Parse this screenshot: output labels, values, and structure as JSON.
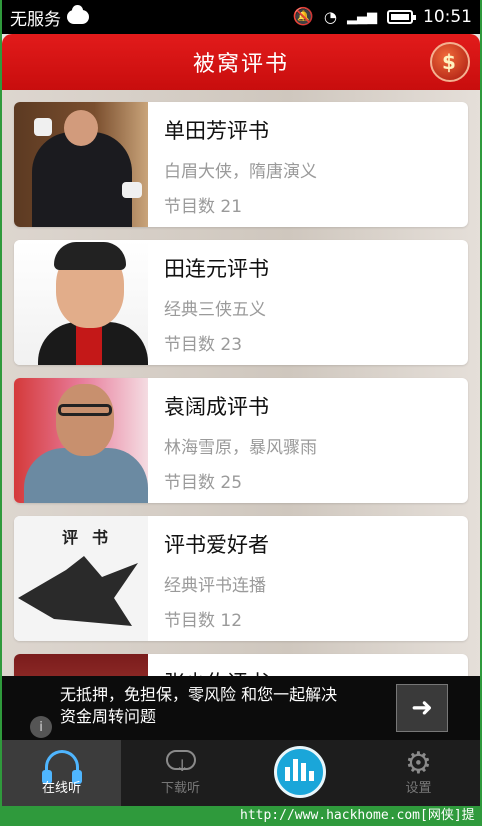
{
  "status_bar": {
    "carrier": "无服务",
    "time": "10:51"
  },
  "header": {
    "title": "被窝评书"
  },
  "list": [
    {
      "title": "单田芳评书",
      "subtitle": "白眉大侠，隋唐演义",
      "count": "节目数 21"
    },
    {
      "title": "田连元评书",
      "subtitle": "经典三侠五义",
      "count": "节目数 23"
    },
    {
      "title": "袁阔成评书",
      "subtitle": "林海雪原，暴风骤雨",
      "count": "节目数 25"
    },
    {
      "title": "评书爱好者",
      "subtitle": "经典评书连播",
      "count": "节目数 12"
    },
    {
      "title": "张少佐评书",
      "subtitle": "",
      "count": ""
    }
  ],
  "thumb4_text": "评书",
  "ad": {
    "line1": "无抵押，免担保，零风险 和您一起解决",
    "line2": "资金周转问题",
    "info_label": "i",
    "arrow": "➜"
  },
  "nav": {
    "tabs": [
      {
        "label": "在线听",
        "active": true
      },
      {
        "label": "下载听",
        "active": false
      },
      {
        "label": "",
        "active": false
      },
      {
        "label": "设置",
        "active": false
      }
    ]
  },
  "watermark": "http://www.hackhome.com[网侠]提供",
  "colors": {
    "header_red": "#d81414",
    "nav_active": "#4fb6ff",
    "center_button": "#1aa6d9"
  }
}
